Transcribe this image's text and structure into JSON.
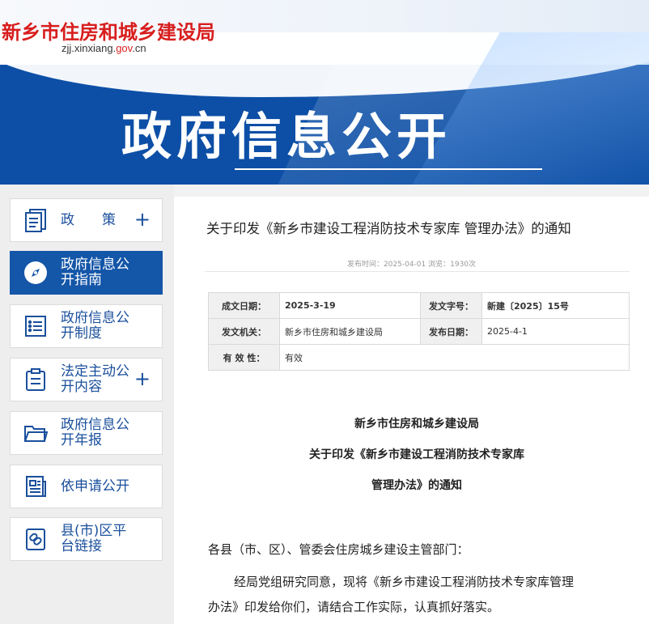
{
  "banner": {
    "site_name": "新乡市住房和城乡建设局",
    "url_prefix": "zjj.xinxiang.",
    "url_gov": "gov",
    "url_suffix": ".cn",
    "title": "政府信息公开"
  },
  "sidebar": {
    "items": [
      {
        "label": "政策",
        "icon": "policy-icon",
        "plus": "+"
      },
      {
        "label": "政府信息公开指南",
        "icon": "compass-icon"
      },
      {
        "label": "政府信息公开制度",
        "icon": "list-doc-icon"
      },
      {
        "label": "法定主动公开内容",
        "icon": "clipboard-icon",
        "plus": "+"
      },
      {
        "label": "政府信息公开年报",
        "icon": "folder-icon"
      },
      {
        "label": "依申请公开",
        "icon": "newspaper-icon"
      },
      {
        "label": "县(市)区平台链接",
        "icon": "link-icon"
      }
    ]
  },
  "article": {
    "title": "关于印发《新乡市建设工程消防技术专家库 管理办法》的通知",
    "meta": "发布时间：2025-04-01 浏览：1930次",
    "info": {
      "row1": {
        "k1": "成文日期：",
        "v1": "2025-3-19",
        "k2": "发文字号：",
        "v2": "新建〔2025〕15号"
      },
      "row2": {
        "k1": "发文机关：",
        "v1": "新乡市住房和城乡建设局",
        "k2": "发布日期：",
        "v2": "2025-4-1"
      },
      "row3": {
        "k1": "有 效 性：",
        "v1": "有效"
      }
    },
    "heading1": "新乡市住房和城乡建设局",
    "heading2": "关于印发《新乡市建设工程消防技术专家库",
    "heading3": "管理办法》的通知",
    "salutation": "各县（市、区）、管委会住房城乡建设主管部门：",
    "para1_line1": "经局党组研究同意，现将《新乡市建设工程消防技术专家库管理",
    "para1_line2": "办法》印发给你们，请结合工作实际，认真抓好落实。"
  },
  "colors": {
    "brand_blue": "#1456a8",
    "banner_blue": "#0d4fa6",
    "red": "#d81e1e"
  }
}
